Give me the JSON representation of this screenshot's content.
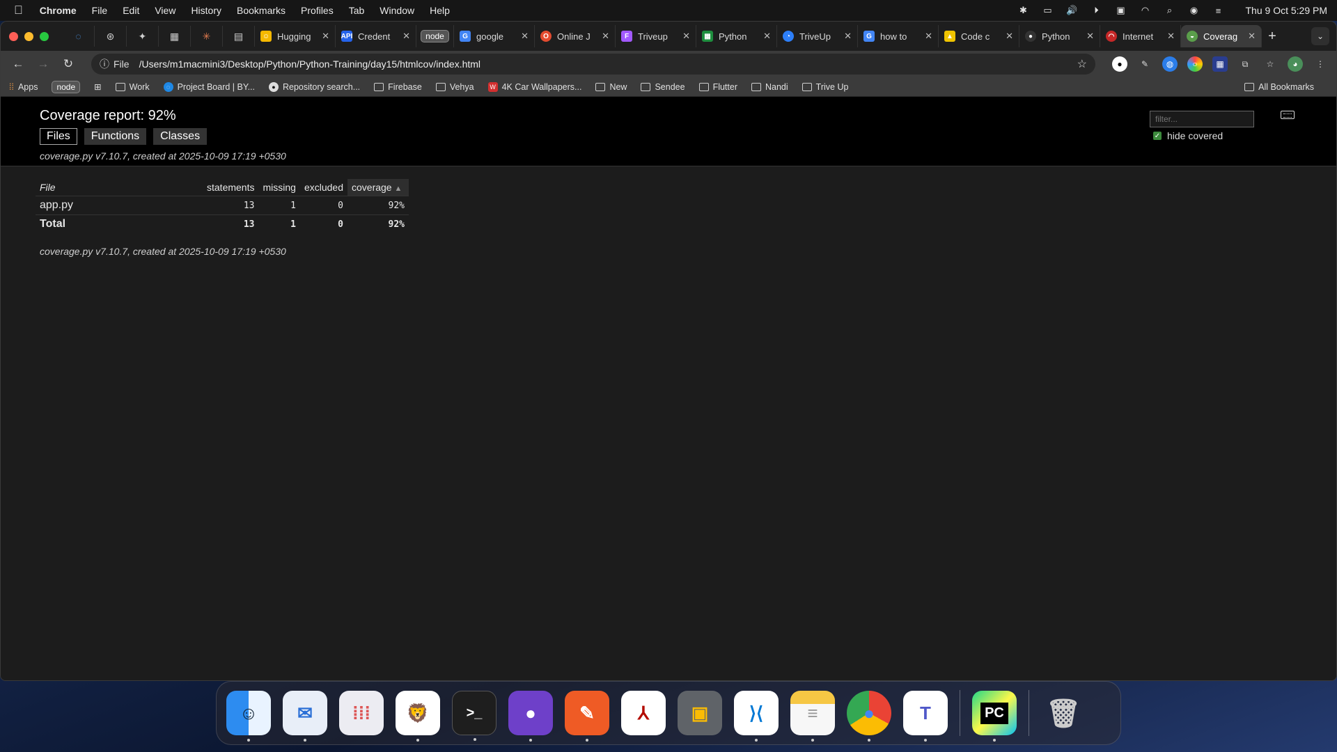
{
  "menubar": {
    "app": "Chrome",
    "items": [
      "File",
      "Edit",
      "View",
      "History",
      "Bookmarks",
      "Profiles",
      "Tab",
      "Window",
      "Help"
    ],
    "clock": "Thu 9 Oct  5:29 PM"
  },
  "tabs": [
    {
      "label": "Hugging",
      "color": "#f5b800"
    },
    {
      "label": "Credent",
      "color": "#2563eb",
      "fav_text": "API"
    },
    {
      "label": "node",
      "is_badge": true
    },
    {
      "label": "google",
      "color": "#4285f4",
      "fav_text": "G"
    },
    {
      "label": "Online J",
      "color": "#e34b2f"
    },
    {
      "label": "Triveup",
      "color": "#a259ff"
    },
    {
      "label": "Python",
      "color": "#1e8e3e"
    },
    {
      "label": "TriveUp",
      "color": "#2d7ff9"
    },
    {
      "label": "how to",
      "color": "#4285f4",
      "fav_text": "G"
    },
    {
      "label": "Code c",
      "color": "#f0c400"
    },
    {
      "label": "Python",
      "color": "#333333"
    },
    {
      "label": "Internet",
      "color": "#c62828"
    },
    {
      "label": "Coverag",
      "color": "#5a9e4b",
      "active": true
    }
  ],
  "address": {
    "scheme": "File",
    "url": "/Users/m1macmini3/Desktop/Python/Python-Training/day15/htmlcov/index.html"
  },
  "bookmarks": {
    "items": [
      {
        "label": "Apps",
        "kind": "apps"
      },
      {
        "label": "node",
        "kind": "badge"
      },
      {
        "label": "Work",
        "kind": "folder"
      },
      {
        "label": "Project Board | BY...",
        "kind": "site",
        "color": "#1e88e5"
      },
      {
        "label": "Repository search...",
        "kind": "site",
        "color": "#333333"
      },
      {
        "label": "Firebase",
        "kind": "folder"
      },
      {
        "label": "Vehya",
        "kind": "folder"
      },
      {
        "label": "4K Car Wallpapers...",
        "kind": "site",
        "color": "#d32f2f"
      },
      {
        "label": "New",
        "kind": "folder"
      },
      {
        "label": "Sendee",
        "kind": "folder"
      },
      {
        "label": "Flutter",
        "kind": "folder"
      },
      {
        "label": "Nandi",
        "kind": "folder"
      },
      {
        "label": "Trive Up",
        "kind": "folder"
      }
    ],
    "all": "All Bookmarks"
  },
  "report": {
    "title": "Coverage report: 92%",
    "tabs": [
      "Files",
      "Functions",
      "Classes"
    ],
    "created": "coverage.py v7.10.7, created at 2025-10-09 17:19 +0530",
    "filter_placeholder": "filter...",
    "hide_covered": "hide covered",
    "columns": {
      "file": "File",
      "statements": "statements",
      "missing": "missing",
      "excluded": "excluded",
      "coverage": "coverage"
    },
    "sort_arrow": "▲",
    "rows": [
      {
        "file": "app.py",
        "statements": "13",
        "missing": "1",
        "excluded": "0",
        "coverage": "92%"
      }
    ],
    "total": {
      "file": "Total",
      "statements": "13",
      "missing": "1",
      "excluded": "0",
      "coverage": "92%"
    }
  },
  "dock": [
    {
      "name": "finder",
      "color": "#2d8cf0"
    },
    {
      "name": "thunderbird",
      "color": "#2a6fd6"
    },
    {
      "name": "launchpad",
      "color": "#e9e9ef"
    },
    {
      "name": "brave",
      "color": "#f2f2f2"
    },
    {
      "name": "terminal",
      "color": "#1e1e1e"
    },
    {
      "name": "github-desktop",
      "color": "#6e40c9"
    },
    {
      "name": "postman",
      "color": "#ef5b25"
    },
    {
      "name": "acrobat",
      "color": "#b30b00"
    },
    {
      "name": "google-meet",
      "color": "#5f6368"
    },
    {
      "name": "vscode",
      "color": "#ffffff"
    },
    {
      "name": "notes",
      "color": "#f3f3f3"
    },
    {
      "name": "chrome",
      "color": "#ffffff"
    },
    {
      "name": "teams",
      "color": "#ffffff"
    },
    {
      "name": "pycharm",
      "color": "#111111"
    },
    {
      "name": "trash",
      "color": "#bcbcbc"
    }
  ]
}
